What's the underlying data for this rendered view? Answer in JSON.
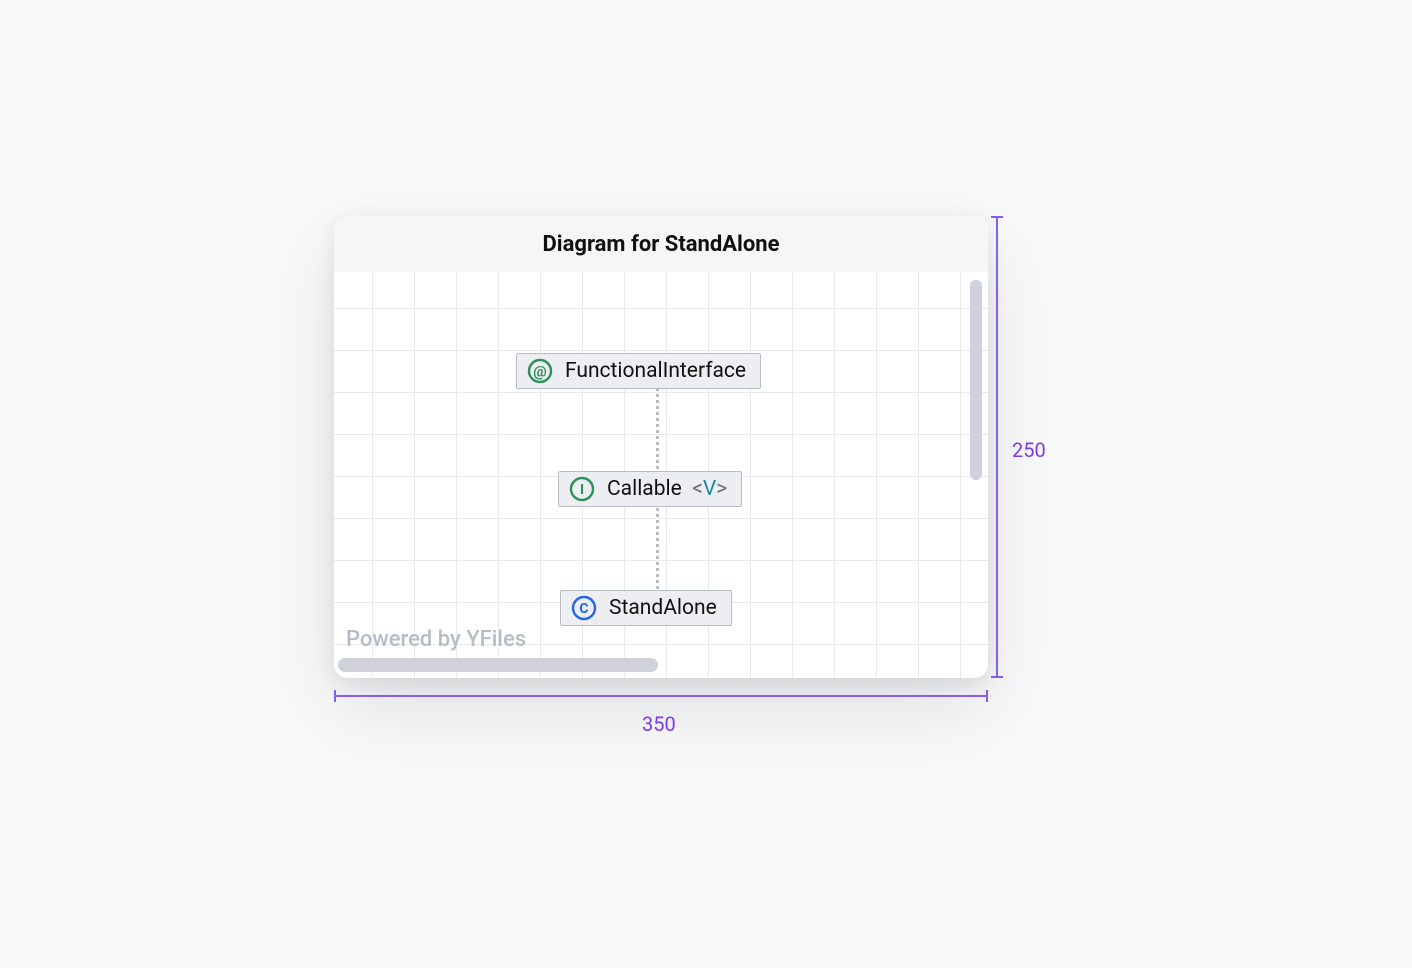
{
  "header": {
    "title": "Diagram for StandAlone"
  },
  "nodes": {
    "functional_interface": {
      "label": "FunctionalInterface",
      "kind": "annotation"
    },
    "callable": {
      "label": "Callable",
      "generic": "V",
      "kind": "interface"
    },
    "standalone": {
      "label": "StandAlone",
      "kind": "class"
    }
  },
  "watermark": "Powered by YFiles",
  "dimensions": {
    "width_label": "350",
    "height_label": "250"
  },
  "icons": {
    "annotation_letter": "@",
    "interface_letter": "I",
    "class_letter": "C"
  },
  "colors": {
    "annotation": "#2e8f58",
    "interface": "#2e8f58",
    "class": "#2563eb",
    "accent": "#7c3aed"
  },
  "brackets": {
    "open": "<",
    "close": ">"
  }
}
